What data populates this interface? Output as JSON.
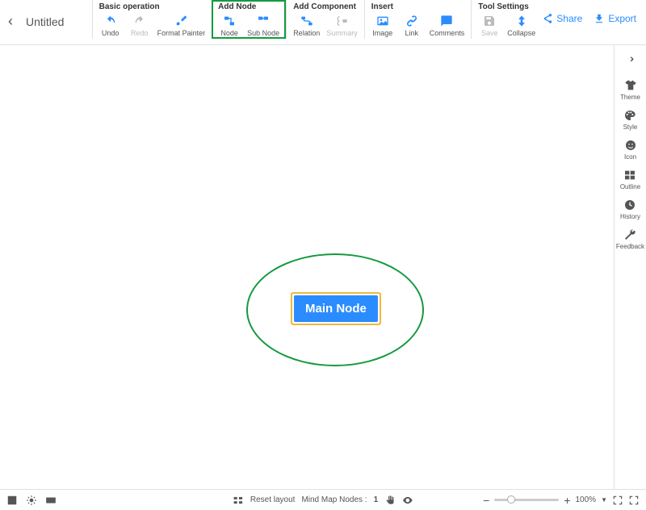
{
  "title": "Untitled",
  "groups": {
    "basic": {
      "title": "Basic operation",
      "undo": "Undo",
      "redo": "Redo",
      "format_painter": "Format Painter"
    },
    "add_node": {
      "title": "Add Node",
      "node": "Node",
      "sub_node": "Sub Node"
    },
    "add_component": {
      "title": "Add Component",
      "relation": "Relation",
      "summary": "Summary"
    },
    "insert": {
      "title": "Insert",
      "image": "Image",
      "link": "Link",
      "comments": "Comments"
    },
    "tool_settings": {
      "title": "Tool Settings",
      "save": "Save",
      "collapse": "Collapse"
    }
  },
  "actions": {
    "share": "Share",
    "export": "Export"
  },
  "sidebar": {
    "theme": "Theme",
    "style": "Style",
    "icon": "Icon",
    "outline": "Outline",
    "history": "History",
    "feedback": "Feedback"
  },
  "canvas": {
    "main_node": "Main Node"
  },
  "bottombar": {
    "reset_layout": "Reset layout",
    "nodes_label": "Mind Map Nodes :",
    "nodes_count": "1",
    "zoom": "100%"
  }
}
